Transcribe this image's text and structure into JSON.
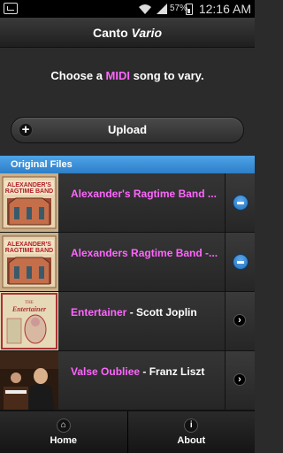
{
  "status_bar": {
    "battery": "57%",
    "time": "12:16 AM"
  },
  "header": {
    "title_part1": "Canto",
    "title_part2": "Vario"
  },
  "prompt": {
    "before": "Choose a ",
    "highlight": "MIDI",
    "after": " song to vary."
  },
  "upload": {
    "label": "Upload"
  },
  "section": {
    "label": "Original Files"
  },
  "files": [
    {
      "title": "Alexander's Ragtime Band ...",
      "artist": "",
      "action": "remove"
    },
    {
      "title": "Alexanders Ragtime Band -...",
      "artist": "",
      "action": "remove"
    },
    {
      "title": "Entertainer",
      "artist": " - Scott Joplin",
      "action": "open"
    },
    {
      "title": "Valse Oubliee",
      "artist": " - Franz Liszt",
      "action": "open"
    }
  ],
  "nav": {
    "home": "Home",
    "about": "About"
  },
  "colors": {
    "accent": "#ff66ff",
    "divider": "#3a8fd8"
  }
}
